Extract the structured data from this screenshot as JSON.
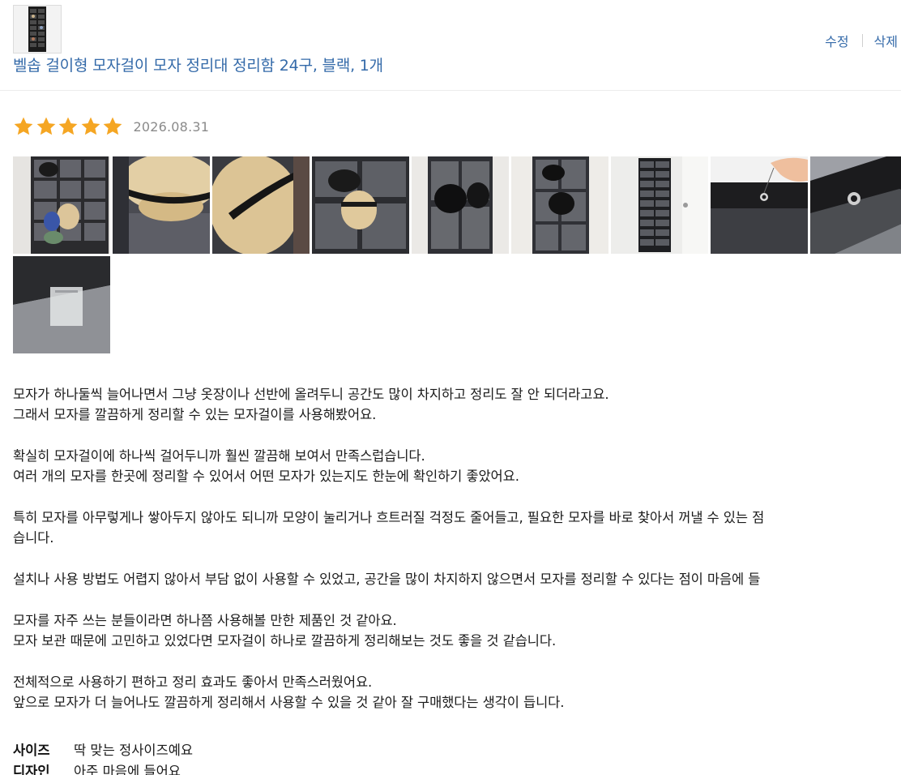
{
  "product": {
    "title": "벨솝 걸이형 모자걸이 모자 정리대 정리함 24구, 블랙, 1개",
    "thumbnail_icon": "product-thumbnail-image"
  },
  "actions": {
    "edit_label": "수정",
    "delete_label": "삭제"
  },
  "review": {
    "rating": 5,
    "max_rating": 5,
    "star_color": "#f5a623",
    "date": "2026.08.31",
    "photo_count": 10,
    "paragraphs": [
      [
        "모자가 하나둘씩 늘어나면서 그냥 옷장이나 선반에 올려두니 공간도 많이 차지하고 정리도 잘 안 되더라고요.",
        "그래서 모자를 깔끔하게 정리할 수 있는 모자걸이를 사용해봤어요."
      ],
      [
        "확실히 모자걸이에 하나씩 걸어두니까 훨씬 깔끔해 보여서 만족스럽습니다.",
        "여러 개의 모자를 한곳에 정리할 수 있어서 어떤 모자가 있는지도 한눈에 확인하기 좋았어요."
      ],
      [
        "특히 모자를 아무렇게나 쌓아두지 않아도 되니까 모양이 눌리거나 흐트러질 걱정도 줄어들고, 필요한 모자를 바로 찾아서 꺼낼 수 있는 점",
        "습니다."
      ],
      [
        "설치나 사용 방법도 어렵지 않아서 부담 없이 사용할 수 있었고, 공간을 많이 차지하지 않으면서 모자를 정리할 수 있다는 점이 마음에 들"
      ],
      [
        "모자를 자주 쓰는 분들이라면 하나쯤 사용해볼 만한 제품인 것 같아요.",
        "모자 보관 때문에 고민하고 있었다면 모자걸이 하나로 깔끔하게 정리해보는 것도 좋을 것 같습니다."
      ],
      [
        "전체적으로 사용하기 편하고 정리 효과도 좋아서 만족스러웠어요.",
        "앞으로 모자가 더 늘어나도 깔끔하게 정리해서 사용할 수 있을 것 같아 잘 구매했다는 생각이 듭니다."
      ]
    ],
    "survey": [
      {
        "key": "사이즈",
        "value": "딱 맞는 정사이즈예요"
      },
      {
        "key": "디자인",
        "value": "아주 마음에 들어요"
      }
    ]
  }
}
